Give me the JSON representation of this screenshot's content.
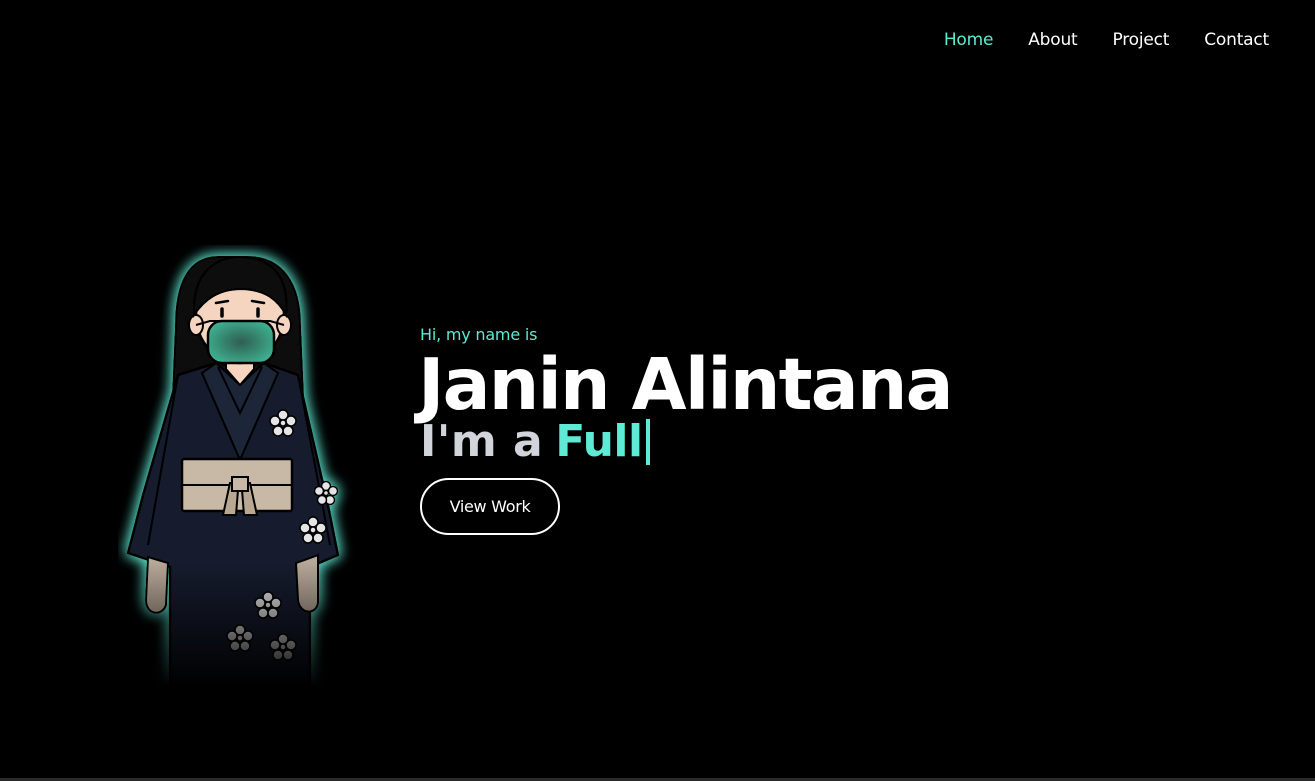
{
  "nav": {
    "items": [
      {
        "label": "Home",
        "active": true
      },
      {
        "label": "About",
        "active": false
      },
      {
        "label": "Project",
        "active": false
      },
      {
        "label": "Contact",
        "active": false
      }
    ]
  },
  "hero": {
    "greeting": "Hi, my name is",
    "name": "Janin Alintana",
    "role_prefix": "I'm a",
    "role_word": "Full",
    "cta_label": "View Work"
  },
  "colors": {
    "background": "#000000",
    "accent": "#5eead4",
    "text": "#ffffff",
    "muted_text": "#d1d5db"
  },
  "avatar": {
    "icon": "kimono-girl-with-mask-illustration"
  }
}
